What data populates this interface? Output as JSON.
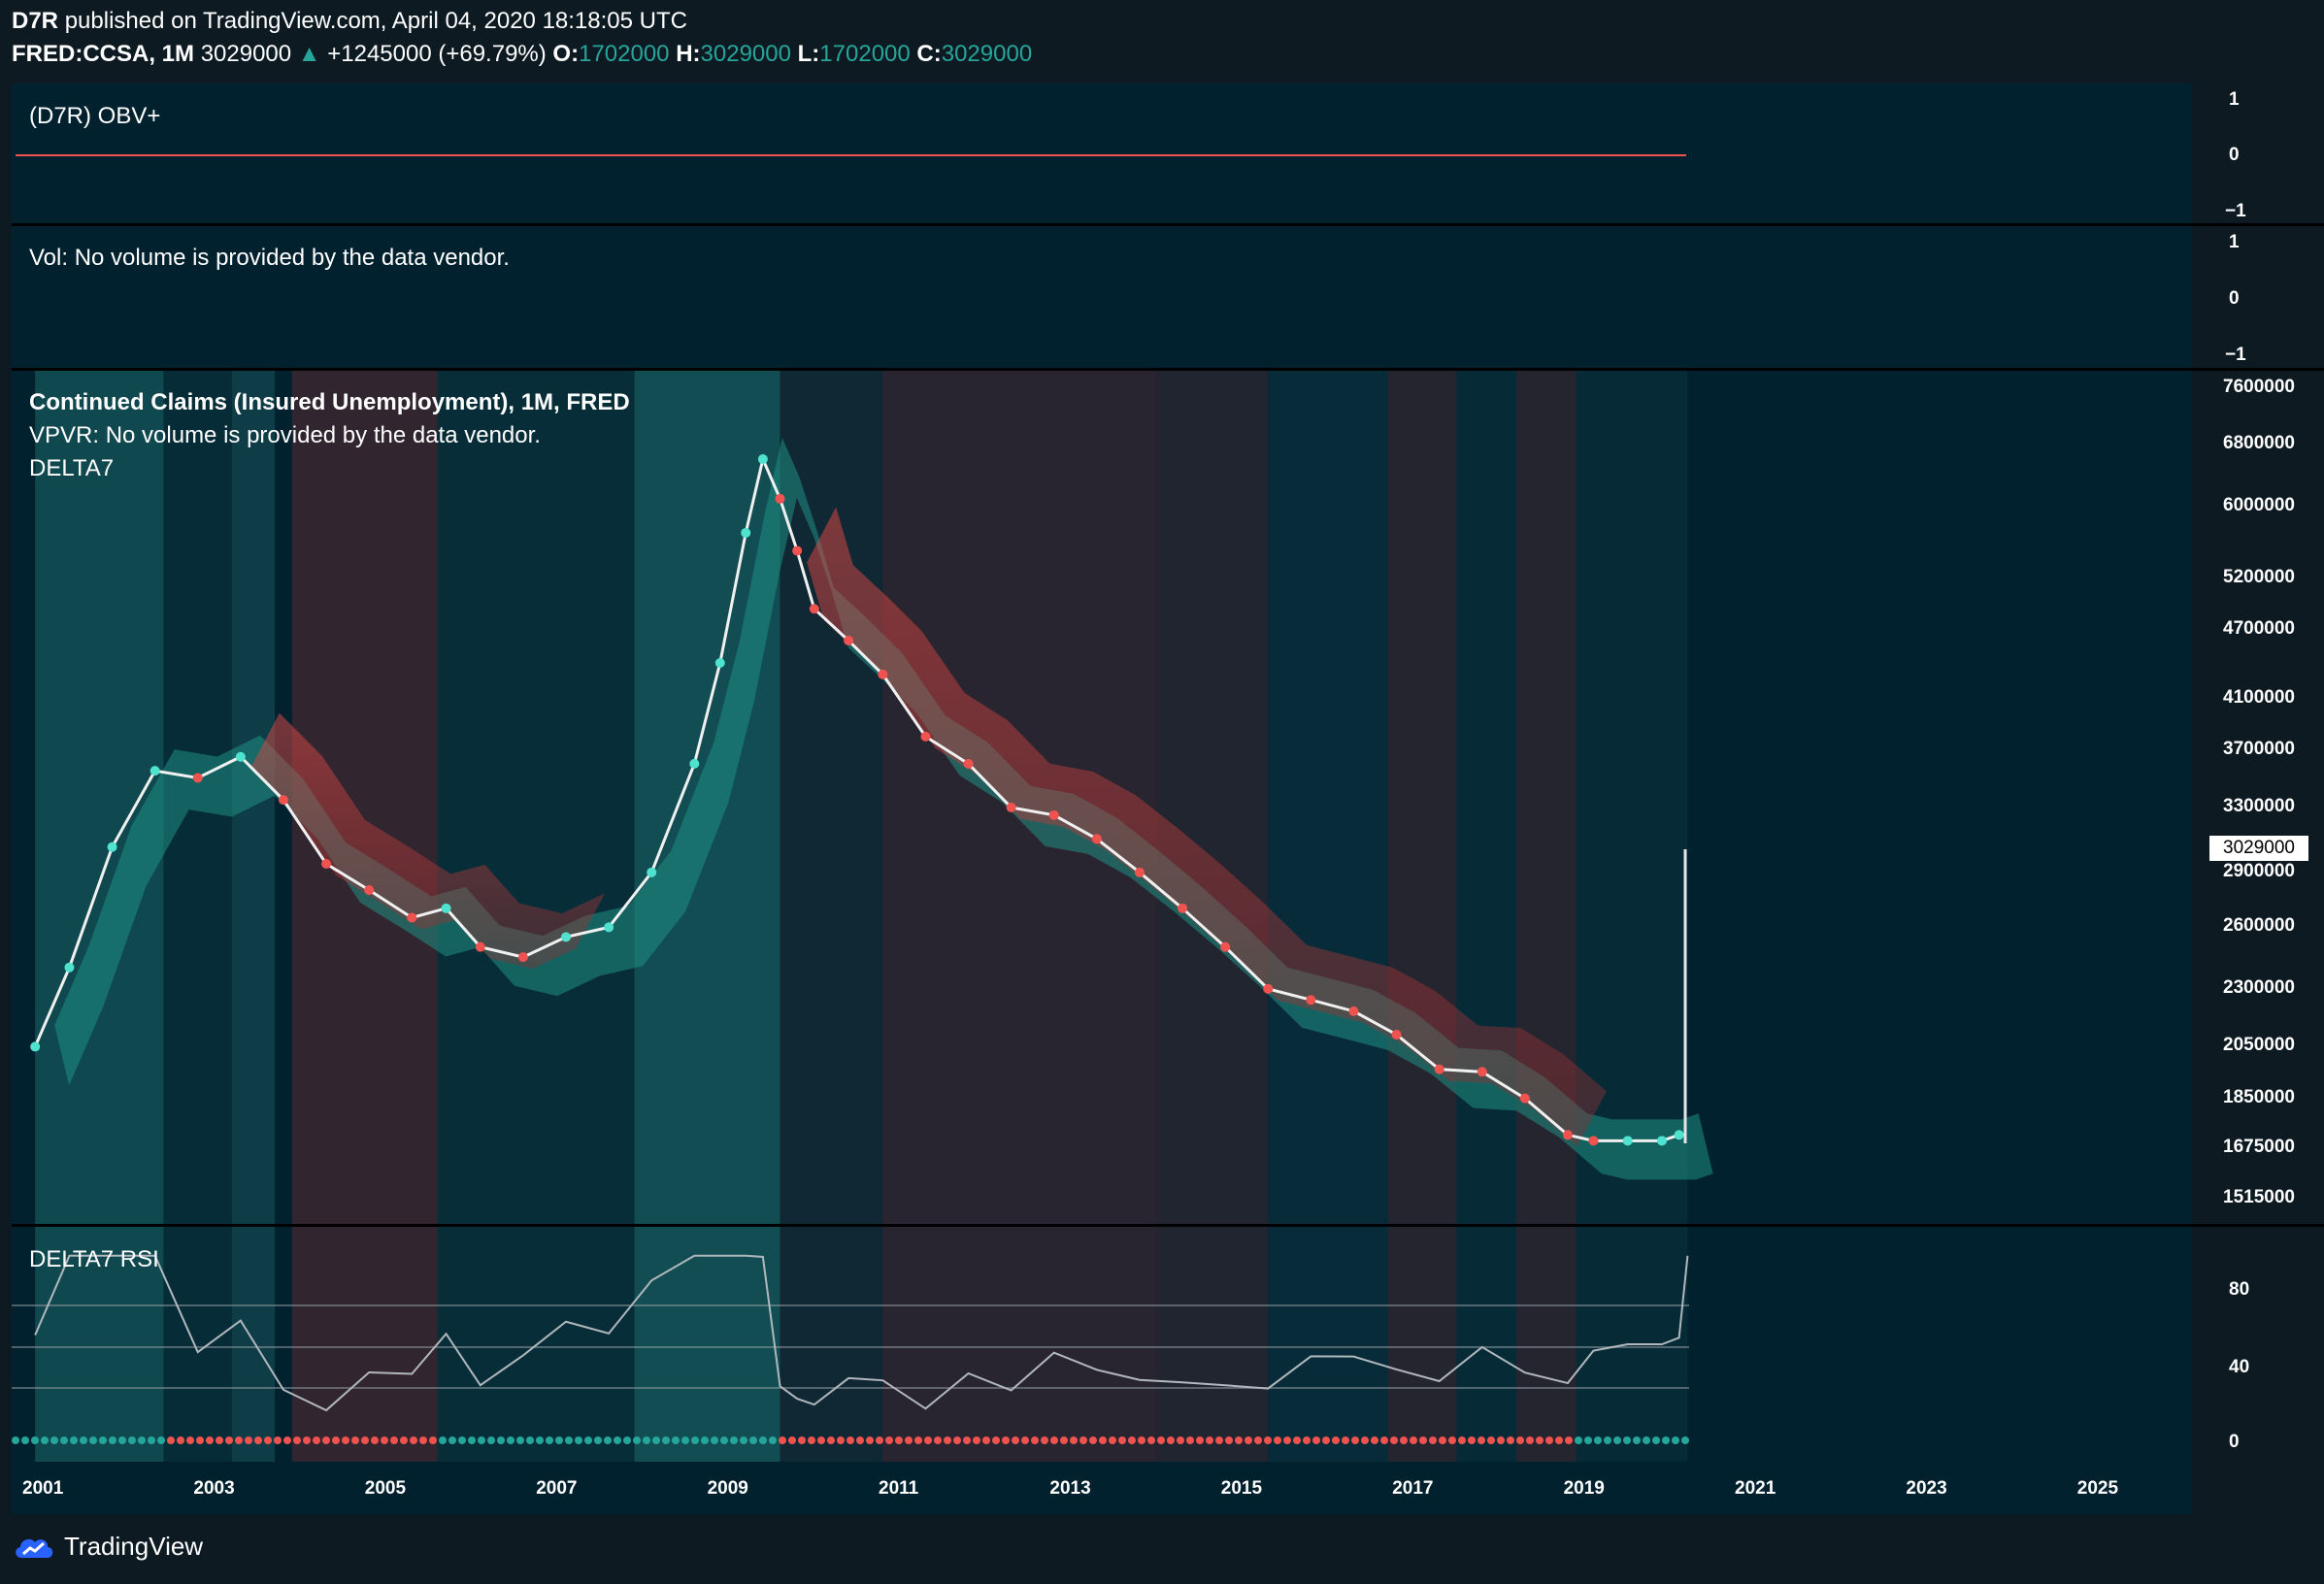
{
  "header": {
    "author": "D7R",
    "published": "published on TradingView.com, April 04, 2020 18:18:05 UTC",
    "symbol": "FRED:CCSA, 1M",
    "last": "3029000",
    "change": "+1245000 (+69.79%)",
    "o_label": "O:",
    "o_value": "1702000",
    "h_label": "H:",
    "h_value": "3029000",
    "l_label": "L:",
    "l_value": "1702000",
    "c_label": "C:",
    "c_value": "3029000"
  },
  "panes": {
    "obv_title": "(D7R) OBV+",
    "obv_scale": [
      "1",
      "0",
      "−1"
    ],
    "vol_title": "Vol: No volume is provided by the data vendor.",
    "vol_scale": [
      "1",
      "0",
      "−1"
    ],
    "main_title": "Continued Claims (Insured Unemployment), 1M, FRED",
    "vpvr_text": "VPVR: No volume is provided by the data vendor.",
    "delta_text": "DELTA7",
    "rsi_title": "DELTA7 RSI",
    "rsi_scale": [
      "80",
      "40",
      "0"
    ],
    "current_price_tag": "3029000"
  },
  "price_axis": [
    "7600000",
    "6800000",
    "6000000",
    "5200000",
    "4700000",
    "4100000",
    "3700000",
    "3300000",
    "2900000",
    "2600000",
    "2300000",
    "2050000",
    "1850000",
    "1675000",
    "1515000"
  ],
  "time_axis": [
    "2001",
    "2003",
    "2005",
    "2007",
    "2009",
    "2011",
    "2013",
    "2015",
    "2017",
    "2019",
    "2021",
    "2023",
    "2025"
  ],
  "footer": {
    "brand": "TradingView"
  },
  "colors": {
    "bull": "#26a69a",
    "bear": "#ef5350",
    "pane_bg": "#01212f",
    "page_bg": "#0d1a22"
  },
  "chart_data": {
    "type": "line",
    "title": "Continued Claims (Insured Unemployment), 1M, FRED",
    "log_scale": true,
    "x_range": [
      "2001",
      "2026"
    ],
    "ylim": [
      1515000,
      7600000
    ],
    "series": [
      {
        "name": "FRED:CCSA",
        "x": [
          2000.9,
          2001.3,
          2001.8,
          2002.3,
          2002.8,
          2003.3,
          2003.8,
          2004.3,
          2004.8,
          2005.3,
          2005.7,
          2006.1,
          2006.6,
          2007.1,
          2007.6,
          2008.1,
          2008.6,
          2008.9,
          2009.2,
          2009.4,
          2009.6,
          2009.8,
          2010.0,
          2010.4,
          2010.8,
          2011.3,
          2011.8,
          2012.3,
          2012.8,
          2013.3,
          2013.8,
          2014.3,
          2014.8,
          2015.3,
          2015.8,
          2016.3,
          2016.8,
          2017.3,
          2017.8,
          2018.3,
          2018.8,
          2019.1,
          2019.5,
          2019.9,
          2020.1,
          2020.2
        ],
        "y": [
          2050000,
          2400000,
          3050000,
          3550000,
          3500000,
          3650000,
          3350000,
          2950000,
          2800000,
          2650000,
          2700000,
          2500000,
          2450000,
          2550000,
          2600000,
          2900000,
          3600000,
          4400000,
          5700000,
          6600000,
          6100000,
          5500000,
          4900000,
          4600000,
          4300000,
          3800000,
          3600000,
          3300000,
          3250000,
          3100000,
          2900000,
          2700000,
          2500000,
          2300000,
          2250000,
          2200000,
          2100000,
          1960000,
          1950000,
          1850000,
          1720000,
          1700000,
          1700000,
          1700000,
          1720000,
          3029000
        ]
      }
    ]
  }
}
